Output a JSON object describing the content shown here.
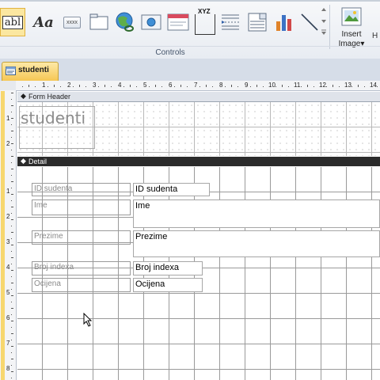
{
  "ribbon": {
    "controls": [
      {
        "name": "label-control-icon",
        "text": "abl"
      },
      {
        "name": "text-box-control-icon",
        "text": "Aa"
      },
      {
        "name": "button-control-icon",
        "text": "xxxx"
      },
      {
        "name": "tab-control-icon",
        "text": ""
      },
      {
        "name": "hyperlink-control-icon",
        "text": ""
      },
      {
        "name": "web-browser-control-icon",
        "text": ""
      },
      {
        "name": "navigation-control-icon",
        "text": ""
      },
      {
        "name": "option-group-control-icon",
        "text": "XYZ"
      },
      {
        "name": "page-break-control-icon",
        "text": ""
      },
      {
        "name": "combo-box-control-icon",
        "text": ""
      },
      {
        "name": "chart-control-icon",
        "text": ""
      },
      {
        "name": "line-control-icon",
        "text": ""
      }
    ],
    "group_label": "Controls",
    "insert_image_line1": "Insert",
    "insert_image_line2": "Image",
    "insert_image_arrow": "▾",
    "more": "H"
  },
  "document_tab": {
    "label": "studenti"
  },
  "sections": {
    "form_header": "Form Header",
    "detail": "Detail"
  },
  "form_title": "studenti",
  "ruler": {
    "h_numbers": [
      "1",
      "2",
      "3",
      "4",
      "5",
      "6",
      "7",
      "8",
      "9",
      "10",
      "11",
      "12",
      "13",
      "14"
    ],
    "v_header_numbers": [
      "1",
      "2"
    ],
    "v_detail_numbers": [
      "1",
      "2",
      "3",
      "4",
      "5",
      "6",
      "7",
      "8"
    ]
  },
  "fields": [
    {
      "label": "ID sudenta",
      "value": "ID sudenta"
    },
    {
      "label": "Ime",
      "value": "Ime"
    },
    {
      "label": "Prezime",
      "value": "Prezime"
    },
    {
      "label": "Broj indexa",
      "value": "Broj indexa"
    },
    {
      "label": "Ocijena",
      "value": "Ocijena"
    }
  ],
  "colors": {
    "accent": "#f6c755",
    "section_bar": "#2b2b2b",
    "grid": "#9a9a9a"
  }
}
